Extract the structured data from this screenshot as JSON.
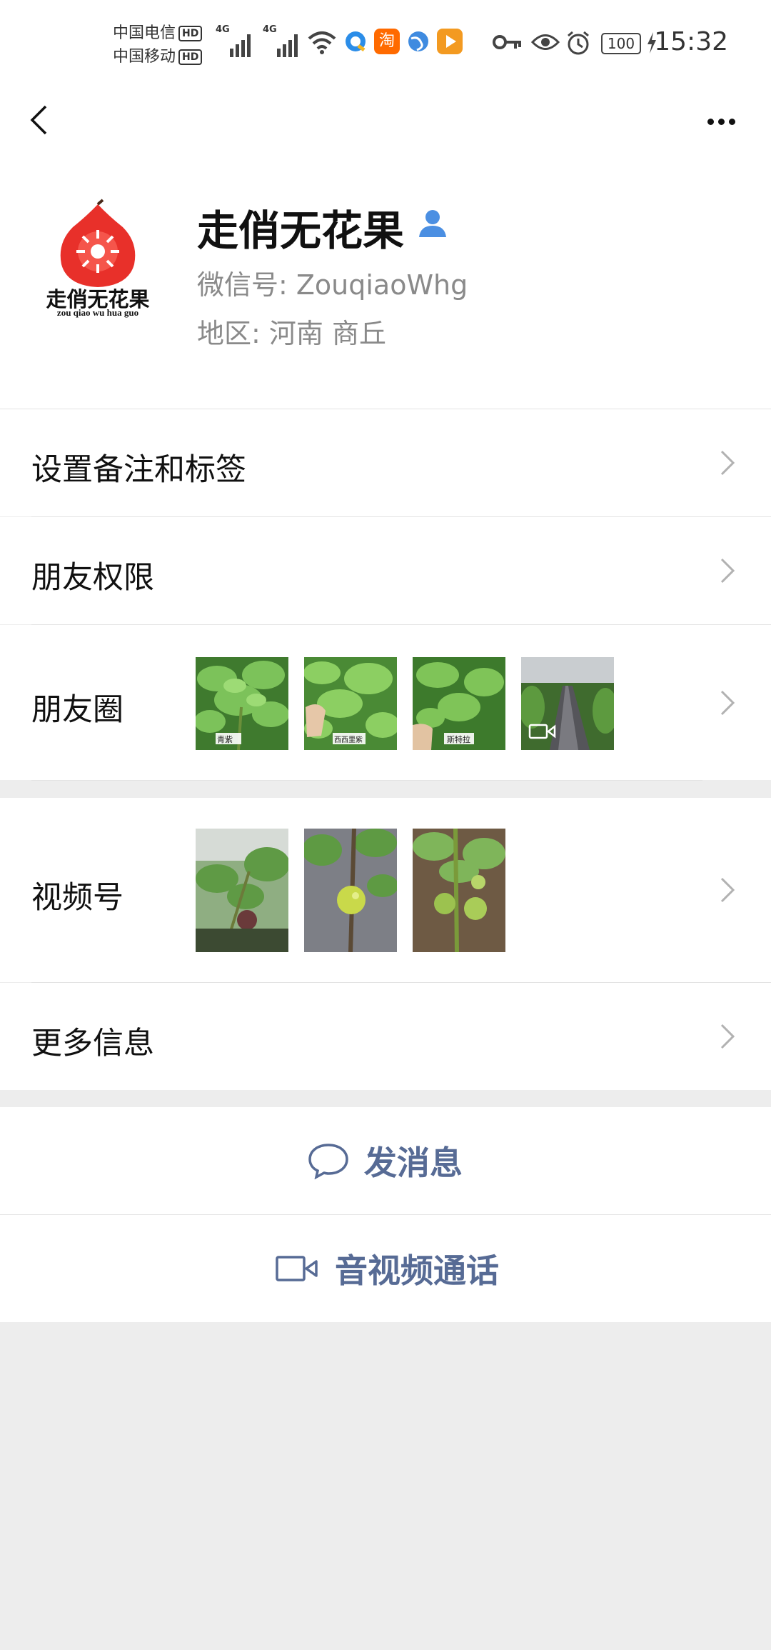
{
  "status_bar": {
    "carrier1": "中国电信",
    "carrier2": "中国移动",
    "hd": "HD",
    "net1": "4G",
    "net2": "4G",
    "battery": "100",
    "time": "15:32",
    "icons": [
      "wifi-icon",
      "browser-icon",
      "taobao-icon",
      "globe-icon",
      "play-icon",
      "key-icon",
      "eye-icon",
      "alarm-icon",
      "battery-icon",
      "charging-icon"
    ]
  },
  "nav": {
    "back_icon": "back-arrow-icon",
    "more_icon": "more-dots-icon"
  },
  "profile": {
    "name": "走俏无花果",
    "wechat_id": "微信号: ZouqiaoWhg",
    "region": "地区: 河南  商丘",
    "logo_text": "走俏无花果",
    "logo_pinyin": "zou qiao wu hua guo"
  },
  "rows": {
    "remark": "设置备注和标签",
    "permissions": "朋友权限",
    "moments": "朋友圈",
    "channels": "视频号",
    "more_info": "更多信息"
  },
  "moments_thumbs": [
    {
      "caption": "青紫"
    },
    {
      "caption": "西西里紫"
    },
    {
      "caption": "斯特拉"
    },
    {
      "caption": "",
      "video": true
    }
  ],
  "actions": {
    "message": "发消息",
    "call": "音视频通话"
  },
  "colors": {
    "link": "#576b95",
    "background": "#ededed",
    "logo_red": "#e8302a"
  }
}
